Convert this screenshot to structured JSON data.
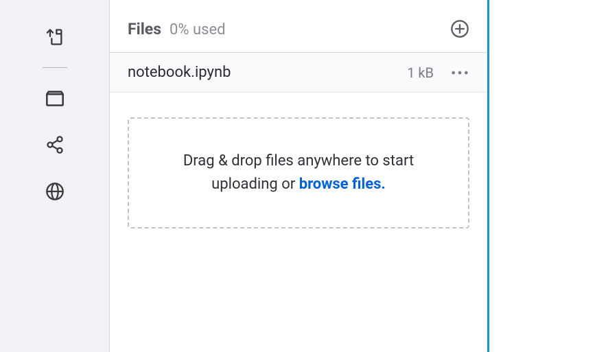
{
  "sidebar": {
    "icons": [
      {
        "name": "upload-file-icon"
      },
      {
        "name": "folder-icon"
      },
      {
        "name": "share-icon"
      },
      {
        "name": "globe-icon"
      }
    ]
  },
  "header": {
    "title": "Files",
    "usage": "0% used"
  },
  "files": [
    {
      "name": "notebook.ipynb",
      "size": "1 kB"
    }
  ],
  "dropzone": {
    "text_prefix": "Drag & drop files anywhere to start uploading or ",
    "browse_label": "browse files."
  }
}
